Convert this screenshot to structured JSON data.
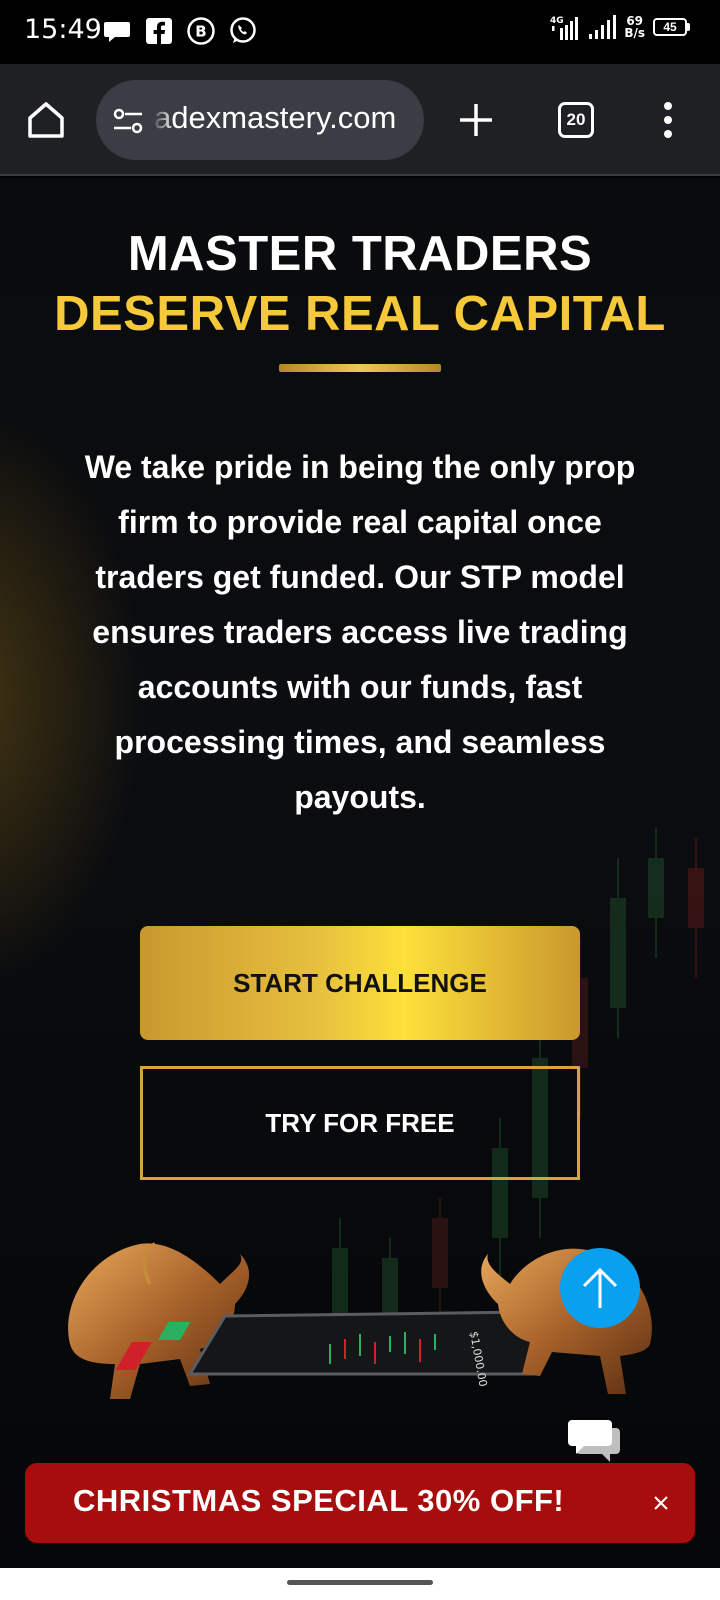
{
  "status_bar": {
    "time": "15:49",
    "icons_left": [
      "chat-bubble-icon",
      "facebook-icon",
      "b-badge-icon",
      "whatsapp-icon"
    ],
    "network_type": "4G",
    "net_speed_value": "69",
    "net_speed_unit": "B/s",
    "battery": "45"
  },
  "browser": {
    "url": "adexmastery.com",
    "tab_count": "20"
  },
  "hero": {
    "title_line1": "MASTER TRADERS",
    "title_line2": "DESERVE REAL CAPITAL",
    "description": "We take pride in being the only prop firm to provide real capital once traders get funded. Our STP model ensures traders access live trading accounts with our funds, fast processing times, and seamless payouts.",
    "primary_button": "START CHALLENGE",
    "secondary_button": "TRY FOR FREE",
    "phone_screen_value": "$1,000.00"
  },
  "promo": {
    "text": "CHRISTMAS SPECIAL 30% OFF!"
  },
  "colors": {
    "gold": "#f5c93a",
    "promo_red": "#a80d0d",
    "scroll_blue": "#0aa0f0"
  }
}
